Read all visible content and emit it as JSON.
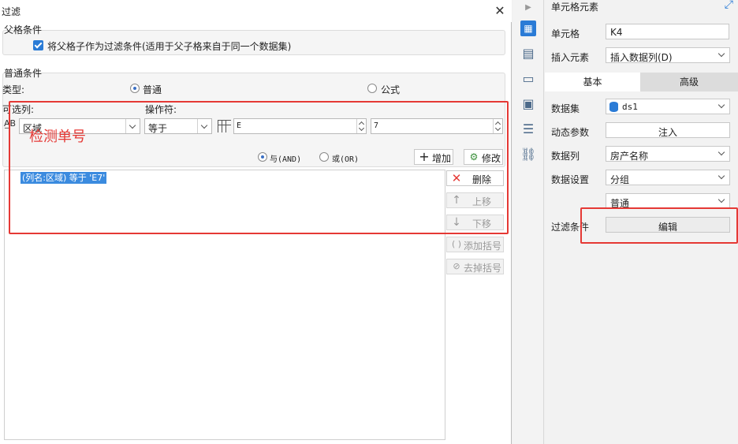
{
  "dialog": {
    "title": "过滤",
    "close_glyph": "✕",
    "parent_group": {
      "title": "父格条件",
      "checkbox_label": "将父格子作为过滤条件(适用于父子格来自于同一个数据集)",
      "checked": true
    },
    "normal_group": {
      "title": "普通条件",
      "type_label": "类型:",
      "type_options": [
        "普通",
        "公式"
      ],
      "type_selected": "普通",
      "column_label": "可选列:",
      "operator_label": "操作符:",
      "column_value": "区域",
      "operator_value": "等于",
      "value_a": "E",
      "value_b": "7",
      "logic_options": [
        "与(AND)",
        "或(OR)"
      ],
      "logic_selected": "与(AND)",
      "add_label": "增加",
      "modify_label": "修改"
    },
    "conditions": [
      "(列名:区域) 等于 'E7'"
    ],
    "side_buttons": {
      "delete": "删除",
      "move_up": "上移",
      "move_down": "下移",
      "add_paren": "添加括号",
      "remove_paren": "去掉括号"
    },
    "annotation": "检测单号"
  },
  "panel": {
    "title": "单元格元素",
    "cell_label": "单元格",
    "cell_value": "K4",
    "insert_label": "插入元素",
    "insert_value": "插入数据列(D)",
    "tabs": [
      "基本",
      "高级"
    ],
    "active_tab": "基本",
    "dataset_label": "数据集",
    "dataset_value": "ds1",
    "dynamic_label": "动态参数",
    "dynamic_button": "注入",
    "column_label": "数据列",
    "column_value": "房产名称",
    "setting_label": "数据设置",
    "setting_value": "分组",
    "setting_sub_value": "普通",
    "filter_label": "过滤条件",
    "filter_button": "编辑"
  },
  "colors": {
    "accent": "#2a7bd6",
    "annotation_red": "#e53935",
    "selection": "#3b8bdf"
  }
}
